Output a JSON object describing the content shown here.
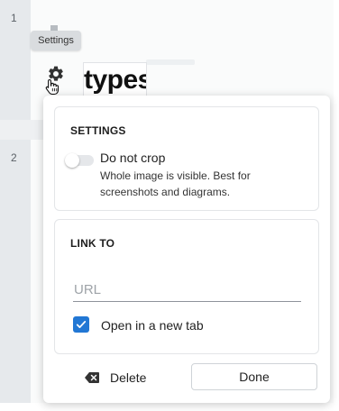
{
  "gutter": {
    "line_numbers": [
      "1",
      "2"
    ]
  },
  "tooltip": {
    "text": "Settings"
  },
  "image_block": {
    "logo_text": "types"
  },
  "popover": {
    "settings": {
      "heading": "SETTINGS",
      "toggle_label": "Do not crop",
      "toggle_on": false,
      "help_text": "Whole image is visible. Best for screenshots and diagrams."
    },
    "link": {
      "heading": "LINK TO",
      "url_value": "",
      "url_placeholder": "URL",
      "new_tab_label": "Open in a new tab",
      "new_tab_checked": true
    },
    "footer": {
      "delete_label": "Delete",
      "done_label": "Done"
    }
  },
  "colors": {
    "accent": "#2277d4"
  }
}
